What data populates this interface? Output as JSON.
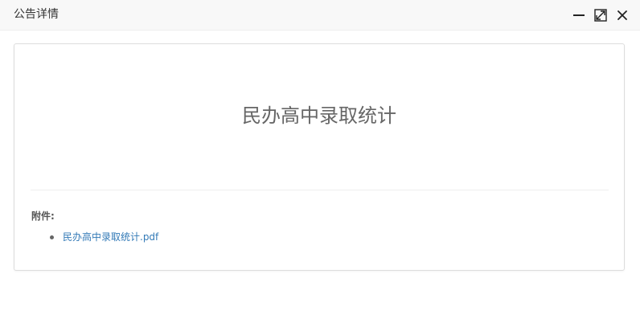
{
  "window": {
    "title": "公告详情",
    "controls": {
      "minimize_icon": "minimize-icon",
      "maximize_icon": "maximize-icon",
      "close_icon": "close-icon"
    }
  },
  "notice": {
    "title": "民办高中录取统计",
    "attachments_label": "附件:",
    "attachments": [
      {
        "name": "民办高中录取统计.pdf"
      }
    ]
  },
  "colors": {
    "link": "#337ab7",
    "titlebar_bg": "#f8f8f8",
    "headline": "#666666"
  }
}
